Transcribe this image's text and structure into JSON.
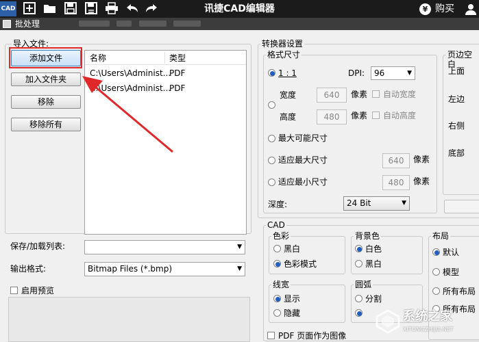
{
  "app": {
    "logo_text": "CAD",
    "title": "讯捷CAD编辑器",
    "buy_label": "购买",
    "buy_coin": "¥"
  },
  "dialog": {
    "title": "批处理"
  },
  "import": {
    "group_label": "导入文件:",
    "buttons": {
      "add_file": "添加文件",
      "add_folder": "加入文件夹",
      "remove": "移除",
      "remove_all": "移除所有"
    },
    "columns": [
      "名称",
      "类型"
    ],
    "rows": [
      {
        "name": "C:\\Users\\Administ...",
        "type": "PDF"
      },
      {
        "name": "C:\\Users\\Administ...",
        "type": "PDF"
      }
    ]
  },
  "save_list": {
    "label": "保存/加载列表:",
    "value": ""
  },
  "output_format": {
    "label": "输出格式:",
    "value": "Bitmap Files (*.bmp)"
  },
  "preview": {
    "label": "启用预览",
    "checked": false
  },
  "converter": {
    "group_label": "转换器设置",
    "format_size": {
      "label": "格式尺寸",
      "ratio_label": "1 : 1",
      "dpi_label": "DPI:",
      "dpi_value": "96",
      "width_label": "宽度",
      "width_value": "640",
      "width_unit": "像素",
      "auto_width": "自动宽度",
      "height_label": "高度",
      "height_value": "480",
      "height_unit": "像素",
      "auto_height": "自动高度",
      "max_possible": "最大可能尺寸",
      "fit_max": "适应最大尺寸",
      "fit_max_value": "640",
      "fit_max_unit": "像素",
      "fit_min": "适应最小尺寸",
      "fit_min_value": "480",
      "fit_min_unit": "像素",
      "depth_label": "深度:",
      "depth_value": "24 Bit",
      "selected": "ratio"
    },
    "margins": {
      "label": "页边空白",
      "top": "上面",
      "left": "左边",
      "right": "右侧",
      "bottom": "底部"
    }
  },
  "cad": {
    "label": "CAD",
    "color": {
      "label": "色彩",
      "options": [
        "黑白",
        "色彩模式"
      ],
      "selected": 1
    },
    "background": {
      "label": "背景色",
      "options": [
        "白色",
        "黑白"
      ],
      "selected": 0
    },
    "layout": {
      "label": "布局",
      "options": [
        "默认",
        "模型",
        "所有布局",
        "所有布局"
      ],
      "selected": 0
    },
    "lineweight": {
      "label": "线宽",
      "options": [
        "显示",
        "隐藏"
      ],
      "selected": 0
    },
    "arc": {
      "label": "圆弧",
      "options": [
        "分割",
        ""
      ],
      "selected": 1
    }
  },
  "pdf_as_image": {
    "label": "PDF 页面作为图像",
    "checked": false
  },
  "watermark": {
    "text": "系统之家",
    "url": "XITONGZHIJIA.NET"
  },
  "colors": {
    "app_bar": "#1b1b1b",
    "highlight": "#e0282a",
    "arrow": "#e0282a",
    "radio_on": "#1f5fbf"
  }
}
